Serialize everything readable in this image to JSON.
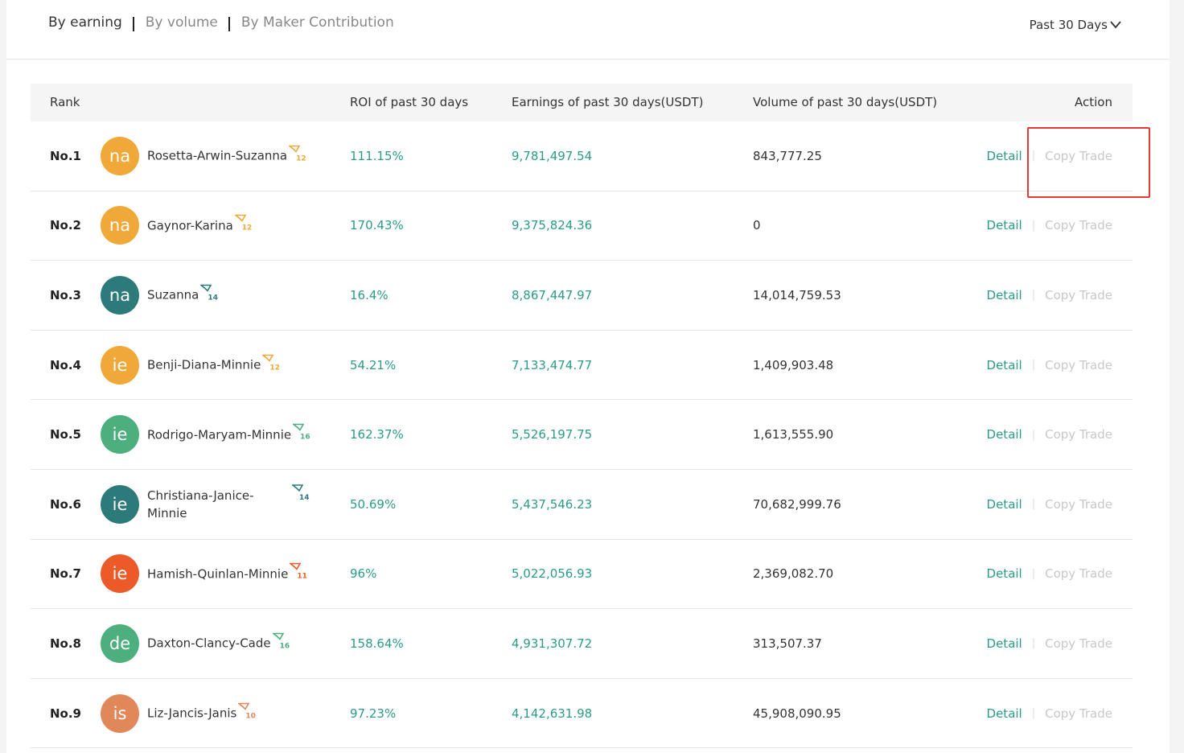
{
  "tabs": [
    {
      "label": "By earning",
      "active": true
    },
    {
      "label": "By volume",
      "active": false
    },
    {
      "label": "By Maker Contribution",
      "active": false
    }
  ],
  "period": {
    "label": "Past 30 Days",
    "icon": "chevron-down-icon"
  },
  "table": {
    "headers": {
      "rank": "Rank",
      "roi": "ROI of past 30 days",
      "earnings": "Earnings of past 30 days(USDT)",
      "volume": "Volume of past 30 days(USDT)",
      "action": "Action"
    },
    "detail_label": "Detail",
    "copy_label": "Copy Trade",
    "rows": [
      {
        "rank": "No.1",
        "avatar": "na",
        "avatar_color": "#f0a838",
        "name": "Rosetta-Arwin-Suzanna",
        "level": "12",
        "level_color": "#f0a838",
        "roi": "111.15%",
        "earnings": "9,781,497.54",
        "volume": "843,777.25"
      },
      {
        "rank": "No.2",
        "avatar": "na",
        "avatar_color": "#f0a838",
        "name": "Gaynor-Karina",
        "level": "12",
        "level_color": "#f0a838",
        "roi": "170.43%",
        "earnings": "9,375,824.36",
        "volume": "0"
      },
      {
        "rank": "No.3",
        "avatar": "na",
        "avatar_color": "#2d7a7a",
        "name": "Suzanna",
        "level": "14",
        "level_color": "#2d7a7a",
        "roi": "16.4%",
        "earnings": "8,867,447.97",
        "volume": "14,014,759.53"
      },
      {
        "rank": "No.4",
        "avatar": "ie",
        "avatar_color": "#f0a838",
        "name": "Benji-Diana-Minnie",
        "level": "12",
        "level_color": "#f0a838",
        "roi": "54.21%",
        "earnings": "7,133,474.77",
        "volume": "1,409,903.48"
      },
      {
        "rank": "No.5",
        "avatar": "ie",
        "avatar_color": "#4caf7d",
        "name": "Rodrigo-Maryam-Minnie",
        "level": "16",
        "level_color": "#4caf7d",
        "roi": "162.37%",
        "earnings": "5,526,197.75",
        "volume": "1,613,555.90"
      },
      {
        "rank": "No.6",
        "avatar": "ie",
        "avatar_color": "#2d7a7a",
        "name": "Christiana-Janice-Minnie",
        "level": "14",
        "level_color": "#2d7a7a",
        "roi": "50.69%",
        "earnings": "5,437,546.23",
        "volume": "70,682,999.76",
        "wrap": true
      },
      {
        "rank": "No.7",
        "avatar": "ie",
        "avatar_color": "#ec5a2a",
        "name": "Hamish-Quinlan-Minnie",
        "level": "11",
        "level_color": "#ec5a2a",
        "roi": "96%",
        "earnings": "5,022,056.93",
        "volume": "2,369,082.70"
      },
      {
        "rank": "No.8",
        "avatar": "de",
        "avatar_color": "#4caf7d",
        "name": "Daxton-Clancy-Cade",
        "level": "16",
        "level_color": "#4caf7d",
        "roi": "158.64%",
        "earnings": "4,931,307.72",
        "volume": "313,507.37"
      },
      {
        "rank": "No.9",
        "avatar": "is",
        "avatar_color": "#e0885a",
        "name": "Liz-Jancis-Janis",
        "level": "10",
        "level_color": "#e0885a",
        "roi": "97.23%",
        "earnings": "4,142,631.98",
        "volume": "45,908,090.95"
      }
    ]
  }
}
